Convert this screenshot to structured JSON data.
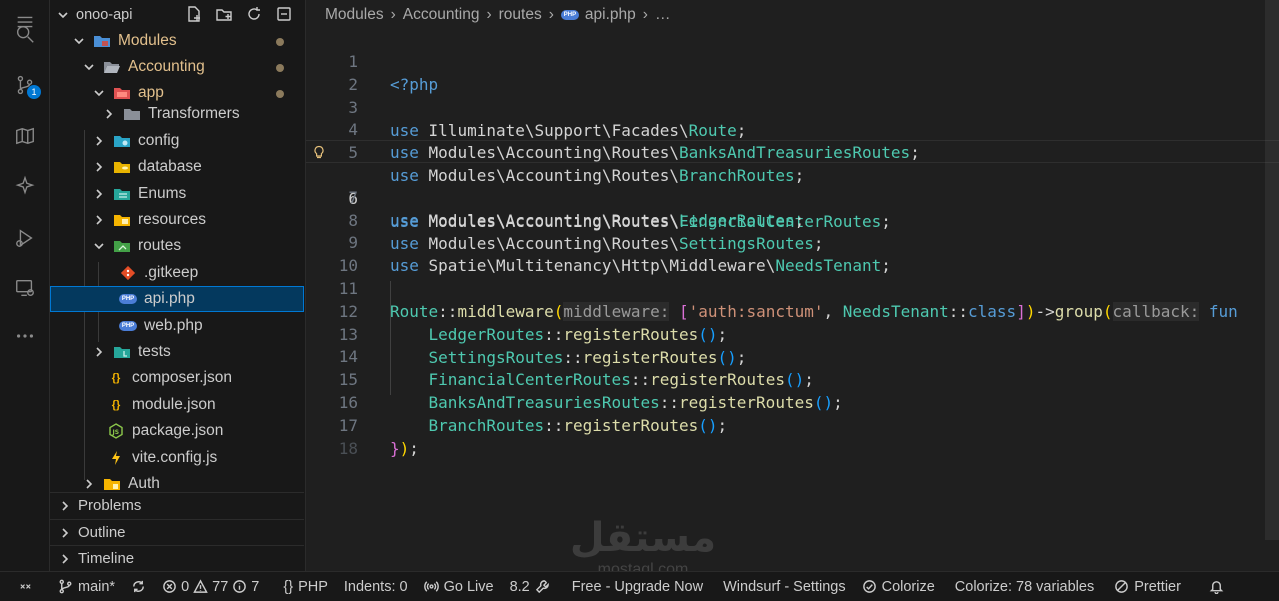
{
  "explorer": {
    "root": "onoo-api",
    "items": [
      {
        "label": "Modules"
      },
      {
        "label": "Accounting"
      },
      {
        "label": "app"
      },
      {
        "label": "Transformers"
      },
      {
        "label": "config"
      },
      {
        "label": "database"
      },
      {
        "label": "Enums"
      },
      {
        "label": "resources"
      },
      {
        "label": "routes"
      },
      {
        "label": ".gitkeep"
      },
      {
        "label": "api.php"
      },
      {
        "label": "web.php"
      },
      {
        "label": "tests"
      },
      {
        "label": "composer.json"
      },
      {
        "label": "module.json"
      },
      {
        "label": "package.json"
      },
      {
        "label": "vite.config.js"
      },
      {
        "label": "Auth"
      }
    ]
  },
  "panels": {
    "problems": "Problems",
    "outline": "Outline",
    "timeline": "Timeline"
  },
  "breadcrumbs": {
    "parts": [
      "Modules",
      "Accounting",
      "routes",
      "api.php",
      "…"
    ],
    "php_badge": "PHP"
  },
  "editor": {
    "current_line": 6,
    "lines": [
      {
        "n": "1"
      },
      {
        "n": "2"
      },
      {
        "n": "3"
      },
      {
        "n": "4"
      },
      {
        "n": "5"
      },
      {
        "n": "6"
      },
      {
        "n": "7"
      },
      {
        "n": "8"
      },
      {
        "n": "9"
      },
      {
        "n": "10"
      },
      {
        "n": "11"
      },
      {
        "n": "12"
      },
      {
        "n": "13"
      },
      {
        "n": "14"
      },
      {
        "n": "15"
      },
      {
        "n": "16"
      },
      {
        "n": "17"
      },
      {
        "n": "18"
      }
    ],
    "tokens": {
      "php_open": "<?php",
      "use": "use",
      "ns_facades": " Illuminate\\Support\\Facades\\",
      "route": "Route",
      "ns_routes": " Modules\\Accounting\\Routes\\",
      "banks": "BanksAndTreasuriesRoutes",
      "branch": "BranchRoutes",
      "financial": "FinancialCenterRoutes",
      "ledger": "LedgerRoutes",
      "settings": "SettingsRoutes",
      "ns_spatie": " Spatie\\Multitenancy\\Http\\Middleware\\",
      "needs_tenant": "NeedsTenant",
      "middleware": "middleware",
      "hint_middleware": "middleware:",
      "auth": "'auth:sanctum'",
      "class_kw": "class",
      "group": "group",
      "hint_callback": "callback:",
      "fun": "fun",
      "register": "registerRoutes"
    }
  },
  "watermark": {
    "logo": "مستقل",
    "sub": "mostaql.com"
  },
  "statusbar": {
    "branch": "main*",
    "errors": "0",
    "warnings": "77",
    "info": "7",
    "language": "PHP",
    "indents": "Indents: 0",
    "golive": "Go Live",
    "version": "8.2",
    "upgrade": "Free - Upgrade Now",
    "windsurf": "Windsurf - Settings",
    "colorize": "Colorize",
    "colorize_vars": "Colorize: 78 variables",
    "prettier": "Prettier"
  },
  "colors": {
    "accent": "#0078d4",
    "selection": "#04395e",
    "keyword": "#569cd6",
    "class": "#4ec9b0",
    "function": "#dcdcaa",
    "string": "#ce9178"
  }
}
